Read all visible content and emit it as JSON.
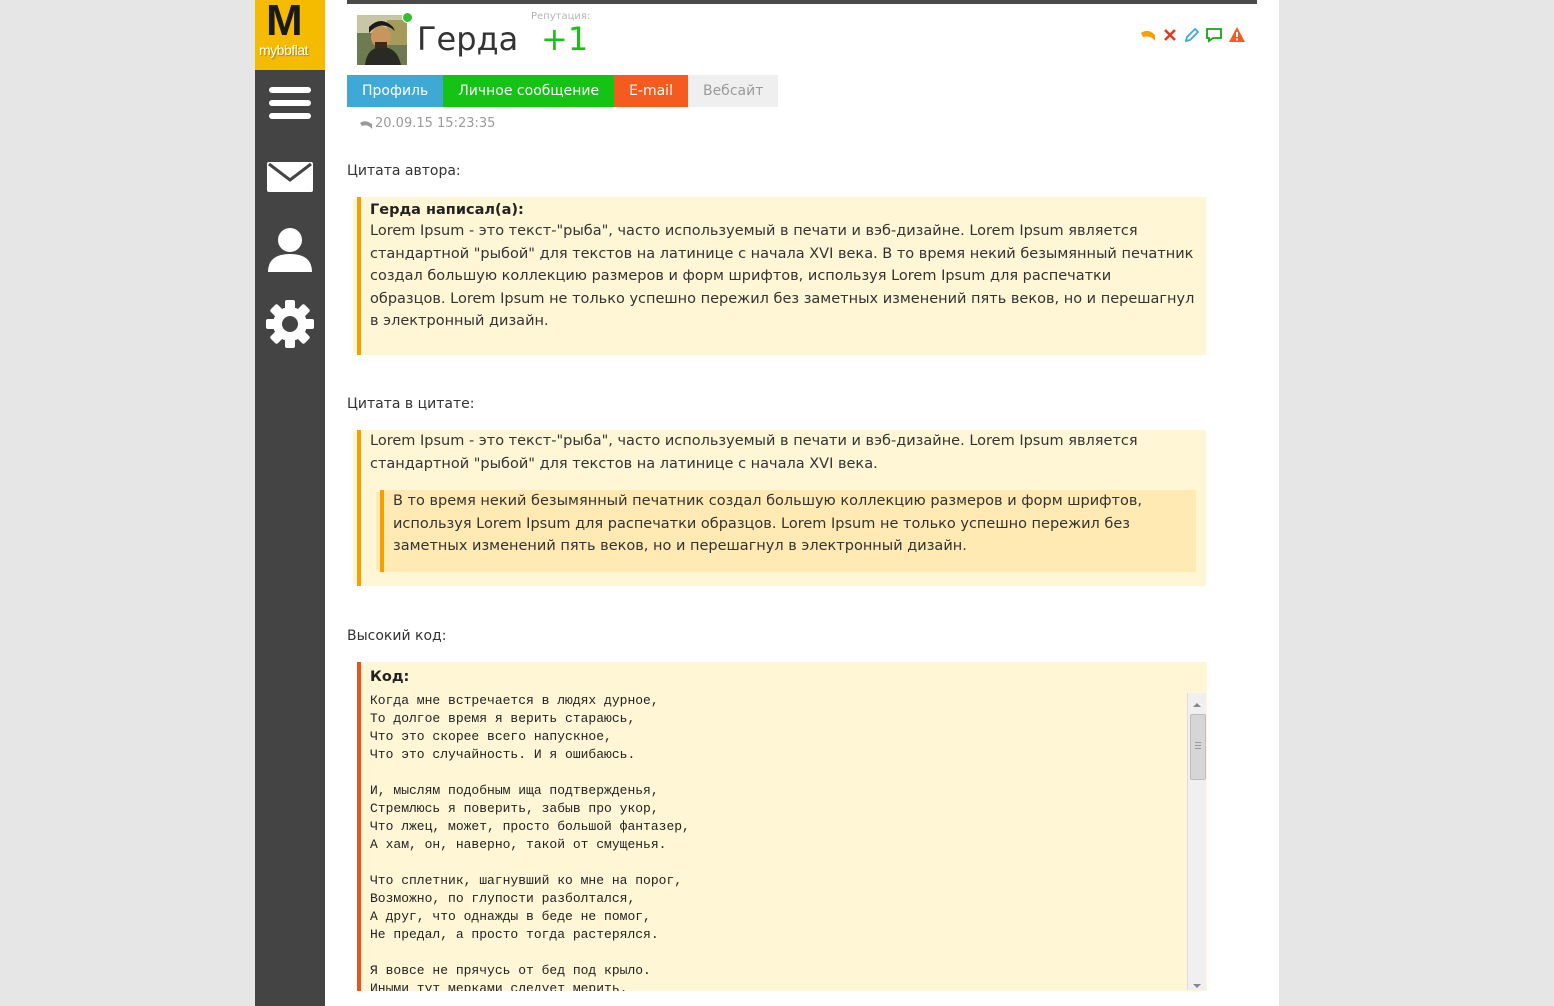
{
  "sidebar": {
    "logo_big": "M",
    "logo_small": "mybbflat",
    "items": [
      {
        "name": "menu-icon"
      },
      {
        "name": "mail-icon"
      },
      {
        "name": "user-icon"
      },
      {
        "name": "gear-icon"
      }
    ]
  },
  "post": {
    "username": "Герда",
    "reputation_label": "Репутация:",
    "reputation_value": "+1",
    "date": "20.09.15 15:23:35",
    "colors": {
      "online": "#2fc22f",
      "reputation": "#18c018"
    }
  },
  "actions": [
    {
      "name": "reply-icon",
      "color": "#f5a000"
    },
    {
      "name": "delete-icon",
      "color": "#e03b1e",
      "glyph": "X"
    },
    {
      "name": "edit-icon",
      "color": "#3fa9d6"
    },
    {
      "name": "quote-icon",
      "color": "#14a314"
    },
    {
      "name": "report-icon",
      "color": "#f55a1e"
    }
  ],
  "tabs": [
    {
      "label": "Профиль",
      "color": "#3fa9d6"
    },
    {
      "label": "Личное сообщение",
      "color": "#14c314"
    },
    {
      "label": "E-mail",
      "color": "#f55a1e"
    },
    {
      "label": "Вебсайт",
      "color": "#efefef"
    }
  ],
  "sections": {
    "author_quote_label": "Цитата автора:",
    "nested_quote_label": "Цитата в цитате:",
    "code_label": "Высокий код:"
  },
  "author_quote": {
    "author": "Герда написал(а):",
    "lines": [
      "Lorem Ipsum - это текст-\"рыба\", часто используемый в печати и вэб-дизайне. Lorem Ipsum является",
      "стандартной \"рыбой\" для текстов на латинице с начала XVI века. В то время некий безымянный печатник",
      "создал большую коллекцию размеров и форм шрифтов, используя Lorem Ipsum для распечатки",
      "образцов. Lorem Ipsum не только успешно пережил без заметных изменений пять веков, но и перешагнул",
      "в электронный дизайн."
    ]
  },
  "nested_quote": {
    "outer_lines": [
      "Lorem Ipsum - это текст-\"рыба\", часто используемый в печати и вэб-дизайне. Lorem Ipsum является",
      "стандартной \"рыбой\" для текстов на латинице с начала XVI века."
    ],
    "inner_lines": [
      "В то время некий безымянный печатник создал большую коллекцию размеров и форм шрифтов,",
      "используя Lorem Ipsum для распечатки образцов. Lorem Ipsum не только успешно пережил без",
      "заметных изменений пять веков, но и перешагнул в электронный дизайн."
    ]
  },
  "code_block": {
    "title": "Код:",
    "text": "Когда мне встречается в людях дурное,\nТо долгое время я верить стараюсь,\nЧто это скорее всего напускное,\nЧто это случайность. И я ошибаюсь.\n\nИ, мыслям подобным ища подтвержденья,\nСтремлюсь я поверить, забыв про укор,\nЧто лжец, может, просто большой фантазер,\nА хам, он, наверно, такой от смущенья.\n\nЧто сплетник, шагнувший ко мне на порог,\nВозможно, по глупости разболтался,\nА друг, что однажды в беде не помог,\nНе предал, а просто тогда растерялся.\n\nЯ вовсе не прячусь от бед под крыло.\nИными тут мерками следует мерить."
  }
}
